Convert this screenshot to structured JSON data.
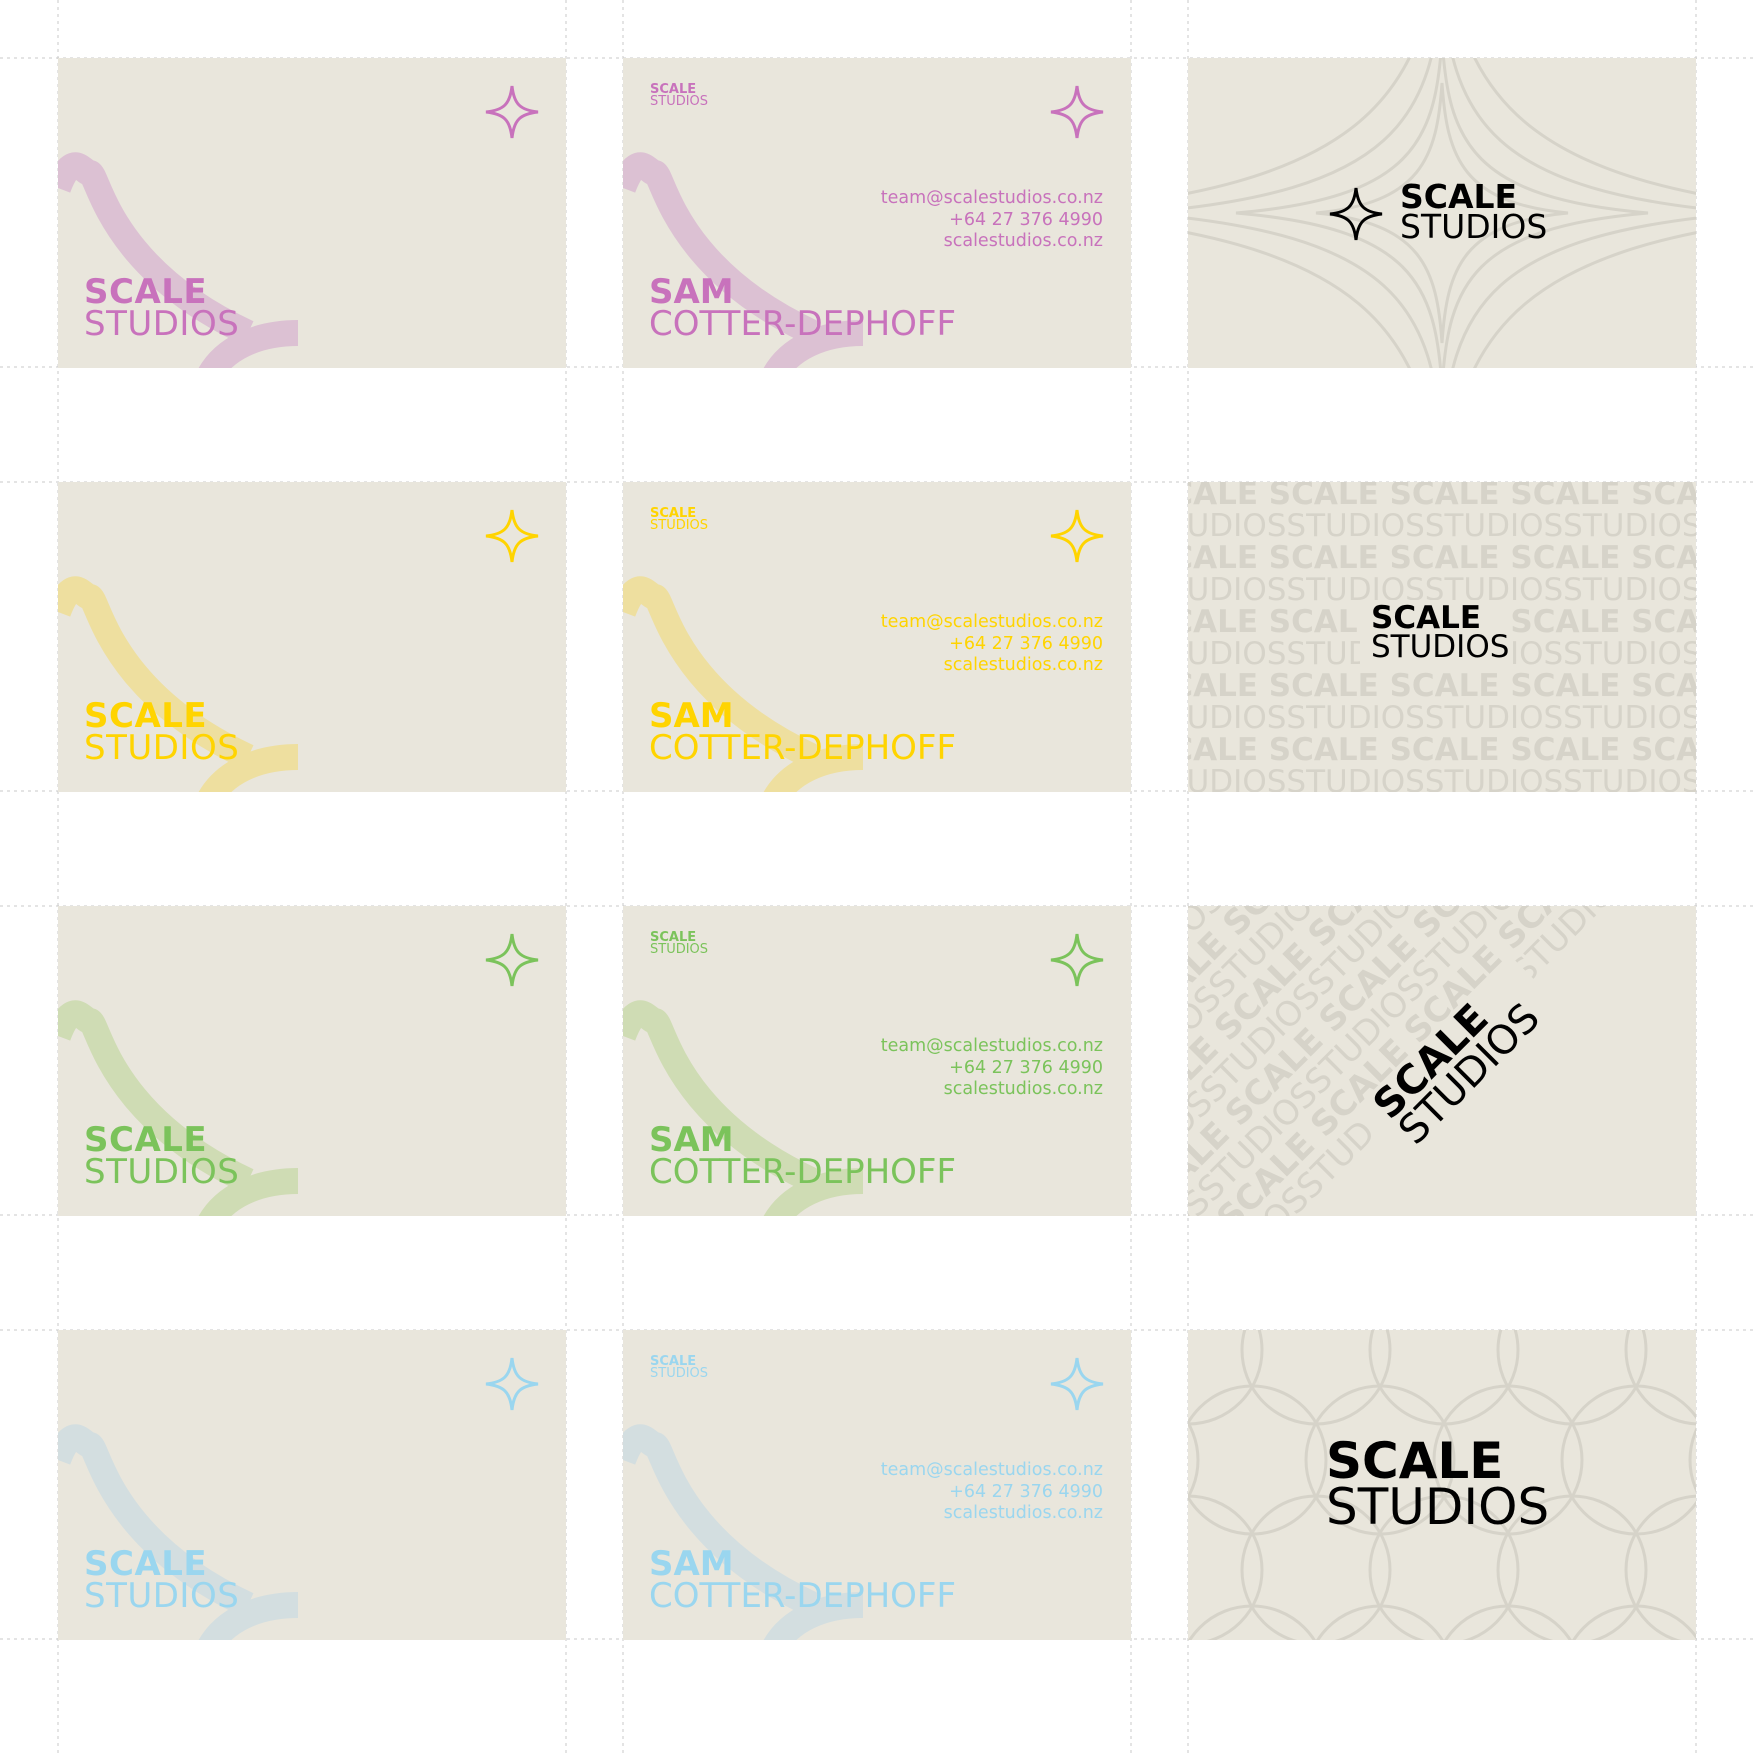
{
  "brand": {
    "line1": "SCALE",
    "line2": "STUDIOS"
  },
  "person": {
    "first": "SAM",
    "last": "COTTER-DEPHOFF"
  },
  "contact": {
    "email": "team@scalestudios.co.nz",
    "phone": "+64 27 376 4990",
    "website": "scalestudios.co.nz"
  },
  "colorways": [
    {
      "name": "pink",
      "color": "#c872bc",
      "soft": "#dcc1d3"
    },
    {
      "name": "yellow",
      "color": "#ffd400",
      "soft": "#eedf9f"
    },
    {
      "name": "green",
      "color": "#7bc35b",
      "soft": "#cfdcb4"
    },
    {
      "name": "blue",
      "color": "#9ad6ef",
      "soft": "#d3dee0"
    }
  ],
  "colors": {
    "card_bg": "#e9e6dc",
    "pattern": "#d6d3c9",
    "logo": "#000000"
  },
  "icons": [
    "four-point-star-icon"
  ]
}
